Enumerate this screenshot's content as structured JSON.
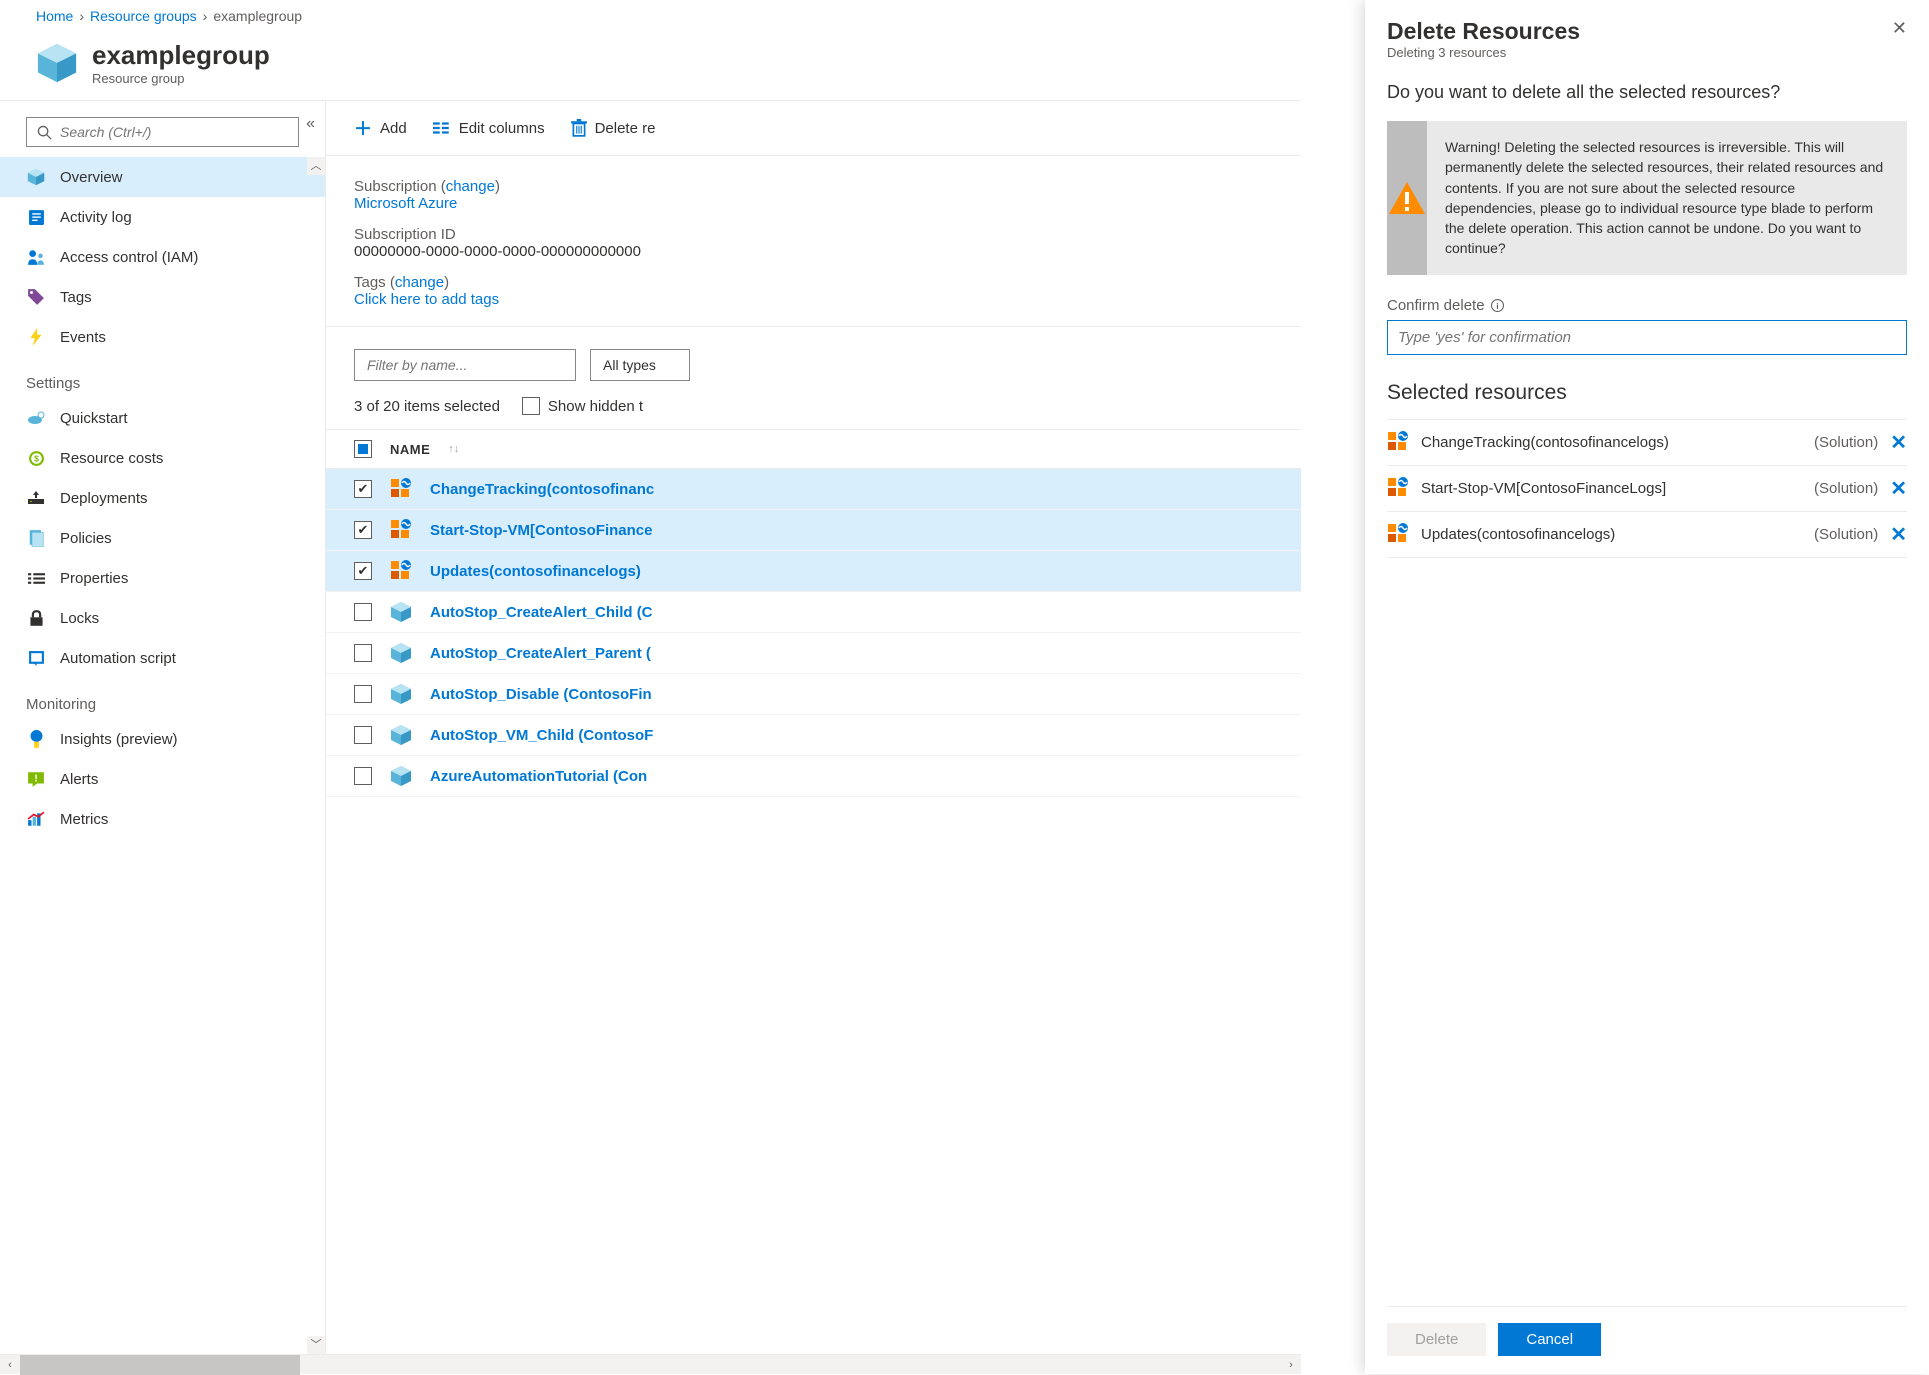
{
  "breadcrumb": {
    "home": "Home",
    "rg": "Resource groups",
    "current": "examplegroup"
  },
  "header": {
    "title": "examplegroup",
    "subtitle": "Resource group"
  },
  "sidebar": {
    "search_placeholder": "Search (Ctrl+/)",
    "items": [
      {
        "label": "Overview",
        "icon": "cube",
        "active": true
      },
      {
        "label": "Activity log",
        "icon": "log"
      },
      {
        "label": "Access control (IAM)",
        "icon": "iam"
      },
      {
        "label": "Tags",
        "icon": "tag"
      },
      {
        "label": "Events",
        "icon": "bolt"
      }
    ],
    "settings_heading": "Settings",
    "settings": [
      {
        "label": "Quickstart",
        "icon": "quickstart"
      },
      {
        "label": "Resource costs",
        "icon": "cost"
      },
      {
        "label": "Deployments",
        "icon": "deploy"
      },
      {
        "label": "Policies",
        "icon": "policy"
      },
      {
        "label": "Properties",
        "icon": "props"
      },
      {
        "label": "Locks",
        "icon": "lock"
      },
      {
        "label": "Automation script",
        "icon": "script"
      }
    ],
    "monitoring_heading": "Monitoring",
    "monitoring": [
      {
        "label": "Insights (preview)",
        "icon": "insights"
      },
      {
        "label": "Alerts",
        "icon": "alerts"
      },
      {
        "label": "Metrics",
        "icon": "metrics"
      }
    ]
  },
  "toolbar": {
    "add": "Add",
    "edit": "Edit columns",
    "del": "Delete re"
  },
  "details": {
    "sub_label": "Subscription",
    "change": "change",
    "sub_val": "Microsoft Azure",
    "subid_label": "Subscription ID",
    "subid_val": "00000000-0000-0000-0000-000000000000",
    "tags_label": "Tags",
    "tags_val": "Click here to add tags"
  },
  "filters": {
    "name_ph": "Filter by name...",
    "types": "All types"
  },
  "selection": {
    "count": "3 of 20 items selected",
    "show_hidden": "Show hidden t"
  },
  "table": {
    "name_col": "NAME"
  },
  "rows": [
    {
      "name": "ChangeTracking(contosofinanc",
      "icon": "solution",
      "sel": true
    },
    {
      "name": "Start-Stop-VM[ContosoFinance",
      "icon": "solution",
      "sel": true
    },
    {
      "name": "Updates(contosofinancelogs)",
      "icon": "solution",
      "sel": true
    },
    {
      "name": "AutoStop_CreateAlert_Child (C",
      "icon": "runbook",
      "sel": false
    },
    {
      "name": "AutoStop_CreateAlert_Parent (",
      "icon": "runbook",
      "sel": false
    },
    {
      "name": "AutoStop_Disable (ContosoFin",
      "icon": "runbook",
      "sel": false
    },
    {
      "name": "AutoStop_VM_Child (ContosoF",
      "icon": "runbook",
      "sel": false
    },
    {
      "name": "AzureAutomationTutorial (Con",
      "icon": "runbook",
      "sel": false
    }
  ],
  "panel": {
    "title": "Delete Resources",
    "subtitle": "Deleting 3 resources",
    "question": "Do you want to delete all the selected resources?",
    "warning": "Warning! Deleting the selected resources is irreversible. This will permanently delete the selected resources, their related resources and contents. If you are not sure about the selected resource dependencies, please go to individual resource type blade to perform the delete operation. This action cannot be undone. Do you want to continue?",
    "confirm_label": "Confirm delete",
    "confirm_ph": "Type 'yes' for confirmation",
    "selected_heading": "Selected resources",
    "selected": [
      {
        "name": "ChangeTracking(contosofinancelogs)",
        "type": "(Solution)"
      },
      {
        "name": "Start-Stop-VM[ContosoFinanceLogs]",
        "type": "(Solution)"
      },
      {
        "name": "Updates(contosofinancelogs)",
        "type": "(Solution)"
      }
    ],
    "delete_btn": "Delete",
    "cancel_btn": "Cancel"
  }
}
